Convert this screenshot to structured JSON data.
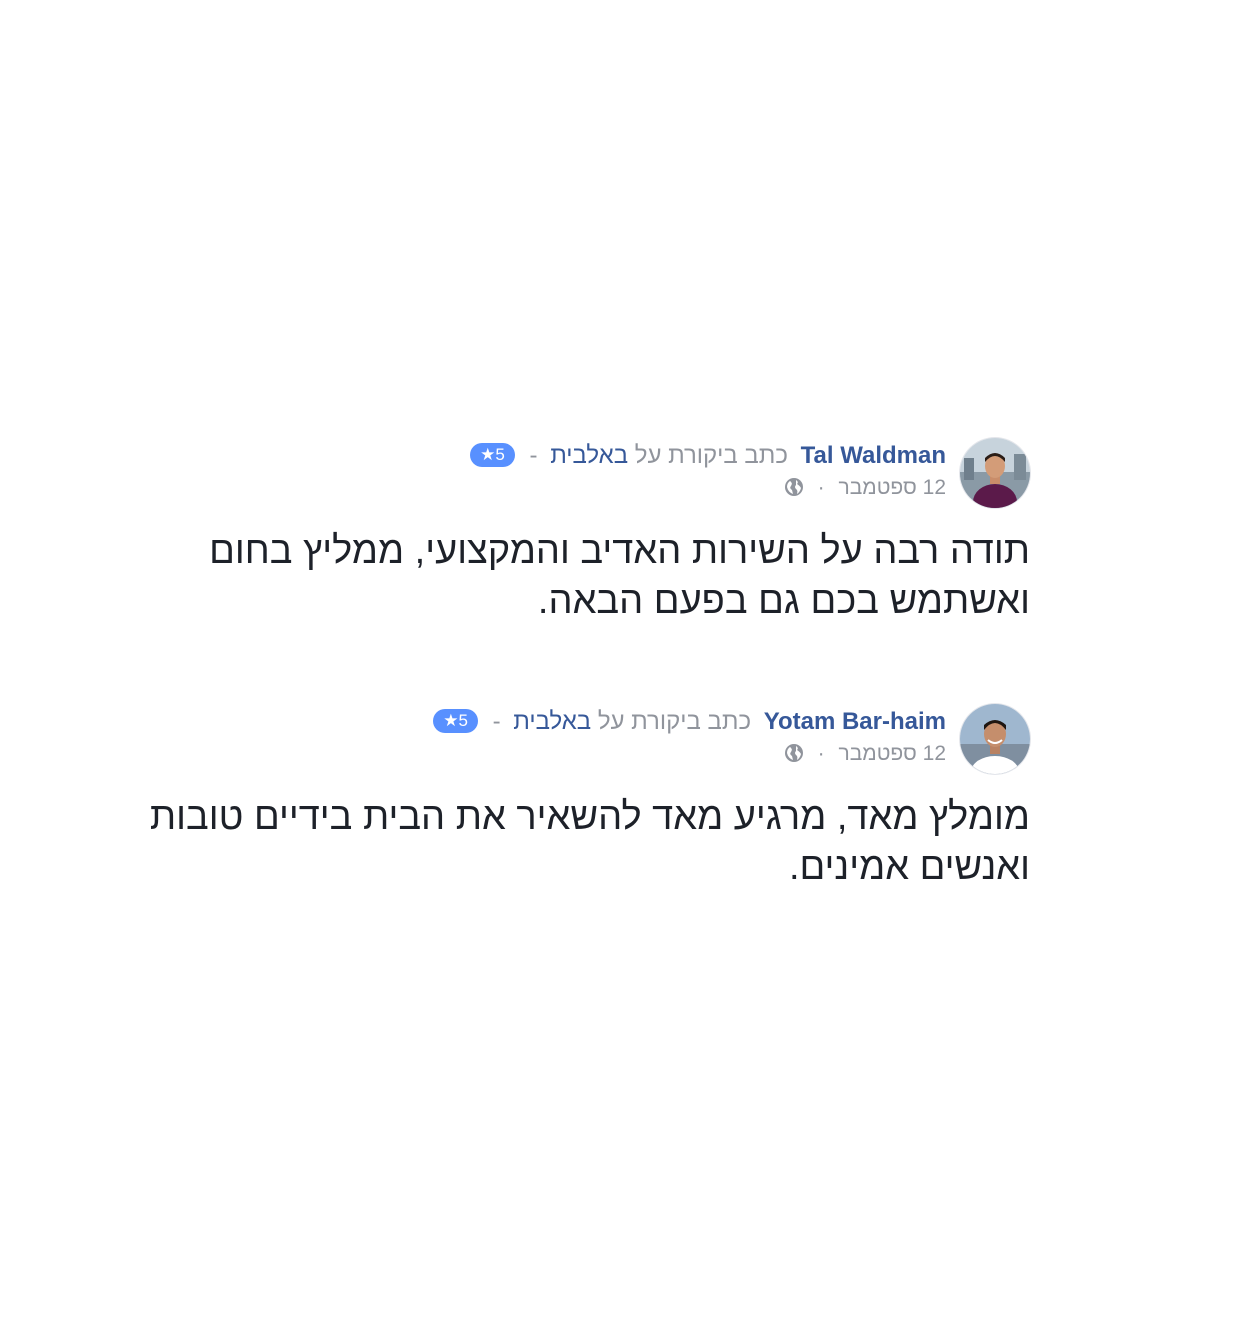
{
  "reviews": [
    {
      "author": "Tal Waldman",
      "verb": "כתב ביקורת על",
      "page": "באלבית",
      "separator": "-",
      "rating_label": "5",
      "rating_star": "★",
      "date": "12 ספטמבר",
      "date_dot": "·",
      "privacy_icon": "globe-icon",
      "text": "תודה רבה על השירות האדיב והמקצועי, ממליץ בחום ואשתמש בכם גם בפעם הבאה."
    },
    {
      "author": "Yotam Bar-haim",
      "verb": "כתב ביקורת על",
      "page": "באלבית",
      "separator": "-",
      "rating_label": "5",
      "rating_star": "★",
      "date": "12 ספטמבר",
      "date_dot": "·",
      "privacy_icon": "globe-icon",
      "text": "מומלץ מאד, מרגיע מאד להשאיר את הבית בידיים טובות ואנשים אמינים."
    }
  ],
  "colors": {
    "link": "#365899",
    "meta": "#90949c",
    "rating_badge": "#5890ff",
    "text": "#1d2129"
  }
}
